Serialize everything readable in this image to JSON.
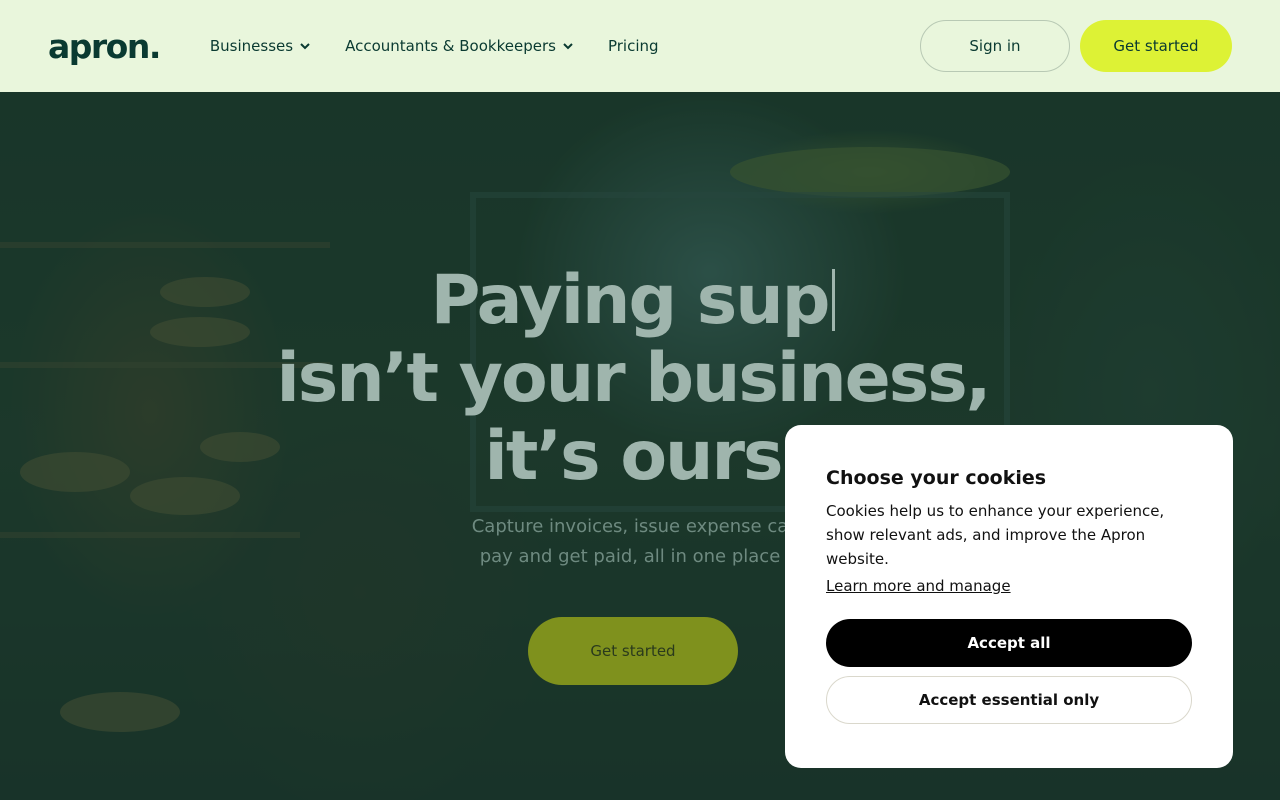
{
  "header": {
    "logo": "apron.",
    "nav": [
      {
        "label": "Businesses",
        "has_dropdown": true
      },
      {
        "label": "Accountants & Bookkeepers",
        "has_dropdown": true
      },
      {
        "label": "Pricing",
        "has_dropdown": false
      }
    ],
    "sign_in_label": "Sign in",
    "get_started_label": "Get started"
  },
  "hero": {
    "headline_line1": "Paying sup",
    "headline_line2": "isn’t your business,",
    "headline_line3": "it’s ours",
    "subline_line1": "Capture invoices, issue expense ca",
    "subline_line2": "pay and get paid, all in one place",
    "cta_label": "Get started"
  },
  "cookie_modal": {
    "title": "Choose your cookies",
    "body": "Cookies help us to enhance your experience, show relevant ads, and improve the Apron website.",
    "link_label": "Learn more and manage",
    "accept_all_label": "Accept all",
    "accept_essential_label": "Accept essential only"
  },
  "colors": {
    "header_bg": "#e9f6dc",
    "brand_dark": "#0a3a31",
    "accent_lime": "#ddf235",
    "overlay": "#0e3428"
  }
}
